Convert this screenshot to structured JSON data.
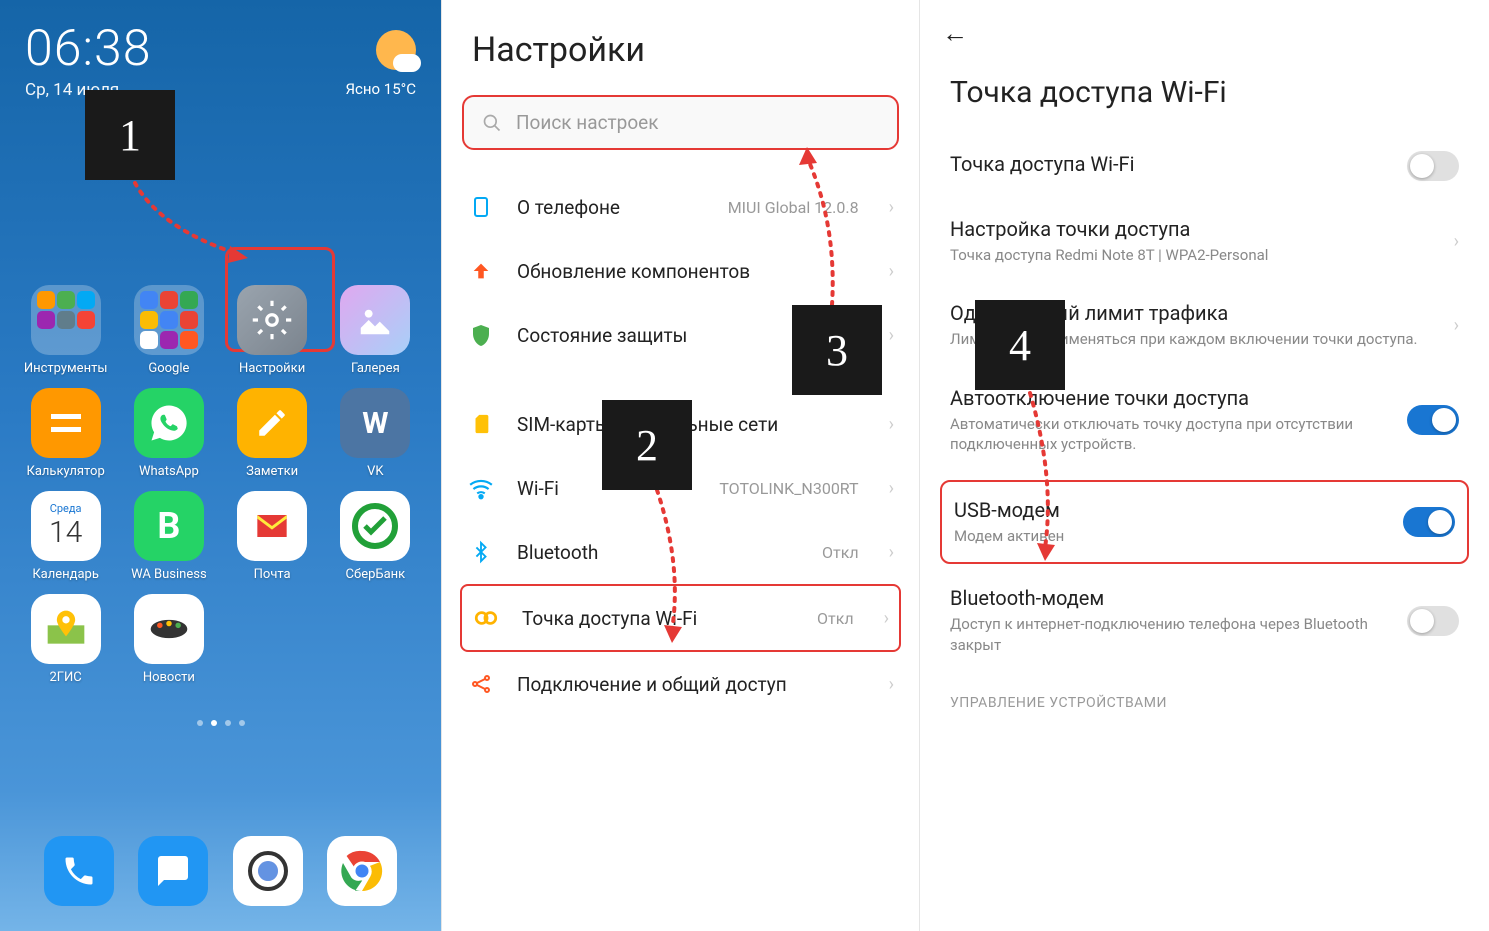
{
  "home": {
    "time": "06:38",
    "date": "Ср, 14 июля",
    "weather": "Ясно  15°C",
    "apps": {
      "r1": [
        "Инструменты",
        "Google",
        "Настройки",
        "Галерея"
      ],
      "r2": [
        "Калькулятор",
        "WhatsApp",
        "Заметки",
        "VK"
      ],
      "r3": [
        "Календарь",
        "WA Business",
        "Почта",
        "СберБанк"
      ],
      "r4": [
        "2ГИС",
        "Новости"
      ]
    },
    "cal_day": "Среда",
    "cal_num": "14"
  },
  "settings": {
    "title": "Настройки",
    "search_ph": "Поиск настроек",
    "rows": {
      "about": "О телефоне",
      "about_v": "MIUI Global 12.0.8",
      "update": "Обновление компонентов",
      "security": "Состояние защиты",
      "sim": "SIM-карты и мобильные сети",
      "wifi": "Wi-Fi",
      "wifi_v": "TOTOLINK_N300RT",
      "bt": "Bluetooth",
      "bt_v": "Откл",
      "hotspot": "Точка доступа Wi-Fi",
      "hotspot_v": "Откл",
      "share": "Подключение и общий доступ"
    }
  },
  "hotspot": {
    "title": "Точка доступа Wi-Fi",
    "r1": "Точка доступа Wi-Fi",
    "r2": "Настройка точки доступа",
    "r2s": "Точка доступа Redmi Note 8T | WPA2-Personal",
    "r3": "Однократный лимит трафика",
    "r3s": "Лимит будет применяться при каждом включении точки доступа.",
    "r4": "Автоотключение точки доступа",
    "r4s": "Автоматически отключать точку доступа при отсутствии подключенных устройств.",
    "r5": "USB-модем",
    "r5s": "Модем активен",
    "r6": "Bluetooth-модем",
    "r6s": "Доступ к интернет-подключению телефона через Bluetooth закрыт",
    "section": "УПРАВЛЕНИЕ УСТРОЙСТВАМИ"
  },
  "steps": {
    "s1": "1",
    "s2": "2",
    "s3": "3",
    "s4": "4"
  }
}
